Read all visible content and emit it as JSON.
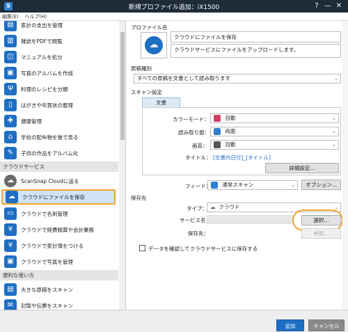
{
  "window": {
    "title": "新規プロファイル追加：iX1500",
    "app_icon": "S"
  },
  "menu": {
    "items": [
      "編集(E)",
      "ヘルプ(H)"
    ]
  },
  "sidebar": {
    "items_top": [
      {
        "label": "家計の支出を管理",
        "icon": "receipt-icon"
      },
      {
        "label": "雑誌をPDFで閲覧",
        "icon": "magazine-icon"
      },
      {
        "label": "マニュアルを処分",
        "icon": "manual-icon"
      },
      {
        "label": "写真のアルバムを作成",
        "icon": "album-icon"
      },
      {
        "label": "料理のレシピを分類",
        "icon": "recipe-icon"
      },
      {
        "label": "はがきや年賀状の整理",
        "icon": "postcard-icon"
      },
      {
        "label": "健康管理",
        "icon": "health-icon"
      },
      {
        "label": "学校の配布物を後で見る",
        "icon": "school-icon"
      },
      {
        "label": "子供の作品をアルバム化",
        "icon": "artwork-icon"
      }
    ],
    "section_cloud": "クラウドサービス",
    "items_cloud": [
      {
        "label": "ScanSnap Cloudに送る",
        "icon": "scansnap-cloud-icon"
      },
      {
        "label": "クラウドにファイルを保存",
        "icon": "cloud-upload-icon"
      },
      {
        "label": "クラウドで名刺管理",
        "icon": "business-card-icon"
      },
      {
        "label": "クラウドで経費精算や会計業務",
        "icon": "expense-icon"
      },
      {
        "label": "クラウドで家計簿をつける",
        "icon": "household-budget-icon"
      },
      {
        "label": "クラウドで写真を管理",
        "icon": "photo-icon"
      }
    ],
    "section_useful": "便利な使い方",
    "items_useful": [
      {
        "label": "大きな原稿をスキャン",
        "icon": "large-doc-icon"
      },
      {
        "label": "封筒や伝票をスキャン",
        "icon": "envelope-icon"
      }
    ]
  },
  "main": {
    "profile_name_label": "プロファイル名",
    "profile_name_value": "クラウドにファイルを保存",
    "profile_desc_value": "クラウドサービスにファイルをアップロードします。",
    "doc_type_label": "原稿種別",
    "doc_type_value": "すべての原稿を文書として読み取ります",
    "scan_settings_label": "スキャン設定",
    "tab_document": "文書",
    "color_mode_label": "カラーモード：",
    "color_mode_value": "自動",
    "scan_side_label": "読み取り面：",
    "scan_side_value": "両面",
    "quality_label": "画質：",
    "quality_value": "自動",
    "title_label": "タイトル：",
    "title_value": "[文書内日付]_[タイトル]",
    "detail_button": "詳細設定...",
    "feed_label": "フィード：",
    "feed_value": "通常スキャン",
    "option_button": "オプション...",
    "save_dest_label": "保存先",
    "type_label": "タイプ：",
    "type_value": "クラウド",
    "service_label": "サービス名：",
    "select_button": "選択...",
    "save_to_label": "保存先：",
    "browse_button": "参照...",
    "confirm_checkbox_label": "データを確認してクラウドサービスに保存する"
  },
  "footer": {
    "add_button": "追加",
    "cancel_button": "キャンセル"
  },
  "colors": {
    "titlebar": "#1e2b38",
    "accent_blue": "#1e6fc4",
    "highlight_orange": "#f0a430",
    "selected_bg": "#cfe3f5"
  }
}
